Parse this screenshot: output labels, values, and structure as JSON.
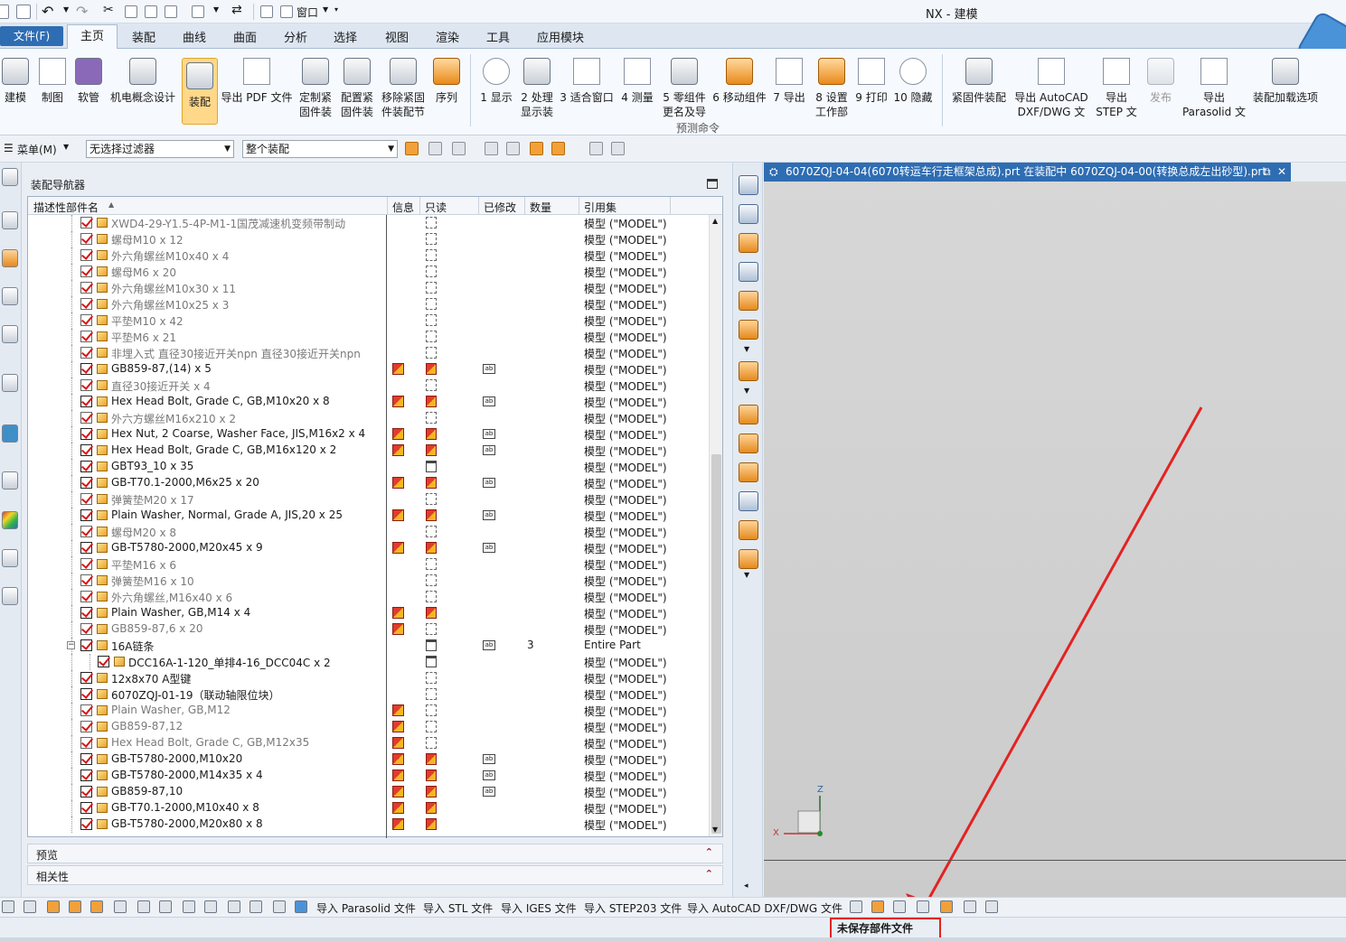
{
  "window": {
    "title": "NX - 建模"
  },
  "menu_tabs": {
    "file": "文件(F)",
    "items": [
      "主页",
      "装配",
      "曲线",
      "曲面",
      "分析",
      "选择",
      "视图",
      "渲染",
      "工具",
      "应用模块"
    ]
  },
  "quick_access": {
    "window_menu": "窗口"
  },
  "ribbon": {
    "buttons": [
      {
        "line1": "建模",
        "line2": ""
      },
      {
        "line1": "制图",
        "line2": ""
      },
      {
        "line1": "软管",
        "line2": ""
      },
      {
        "line1": "机电概念设计",
        "line2": ""
      },
      {
        "line1": "装配",
        "line2": ""
      },
      {
        "line1": "导出 PDF 文件",
        "line2": ""
      },
      {
        "line1": "定制紧",
        "line2": "固件装"
      },
      {
        "line1": "配置紧",
        "line2": "固件装"
      },
      {
        "line1": "移除紧固",
        "line2": "件装配节"
      },
      {
        "line1": "序列",
        "line2": ""
      },
      {
        "line1": "1 显示",
        "line2": ""
      },
      {
        "line1": "2 处理",
        "line2": "显示装"
      },
      {
        "line1": "3 适合窗口",
        "line2": ""
      },
      {
        "line1": "4 测量",
        "line2": ""
      },
      {
        "line1": "5 零组件",
        "line2": "更名及导"
      },
      {
        "line1": "6 移动组件",
        "line2": ""
      },
      {
        "line1": "7 导出",
        "line2": ""
      },
      {
        "line1": "8 设置",
        "line2": "工作部"
      },
      {
        "line1": "9 打印",
        "line2": ""
      },
      {
        "line1": "10 隐藏",
        "line2": ""
      },
      {
        "line1": "紧固件装配",
        "line2": ""
      },
      {
        "line1": "导出 AutoCAD",
        "line2": "DXF/DWG 文"
      },
      {
        "line1": "导出",
        "line2": "STEP 文"
      },
      {
        "line1": "发布",
        "line2": ""
      },
      {
        "line1": "导出",
        "line2": "Parasolid 文"
      },
      {
        "line1": "装配加载选项",
        "line2": ""
      }
    ],
    "group_label": "预测命令"
  },
  "filterbar": {
    "menu": "菜单(M)",
    "selection_filter": "无选择过滤器",
    "scope": "整个装配"
  },
  "navigator": {
    "title": "装配导航器",
    "columns": [
      "描述性部件名",
      "信息",
      "只读",
      "已修改",
      "数量",
      "引用集"
    ],
    "rows": [
      {
        "name": "XWD4-29-Y1.5-4P-M1-1国茂减速机变频带制动",
        "dim": true,
        "info": false,
        "ro": "dash",
        "mod": false,
        "qty": "",
        "ref": "模型 (\"MODEL\")",
        "indent": 0
      },
      {
        "name": "螺母M10 x 12",
        "dim": true,
        "info": false,
        "ro": "dash",
        "mod": false,
        "qty": "",
        "ref": "模型 (\"MODEL\")",
        "indent": 0
      },
      {
        "name": "外六角螺丝M10x40 x 4",
        "dim": true,
        "info": false,
        "ro": "dash",
        "mod": false,
        "qty": "",
        "ref": "模型 (\"MODEL\")",
        "indent": 0
      },
      {
        "name": "螺母M6 x 20",
        "dim": true,
        "info": false,
        "ro": "dash",
        "mod": false,
        "qty": "",
        "ref": "模型 (\"MODEL\")",
        "indent": 0
      },
      {
        "name": "外六角螺丝M10x30 x 11",
        "dim": true,
        "info": false,
        "ro": "dash",
        "mod": false,
        "qty": "",
        "ref": "模型 (\"MODEL\")",
        "indent": 0
      },
      {
        "name": "外六角螺丝M10x25 x 3",
        "dim": true,
        "info": false,
        "ro": "dash",
        "mod": false,
        "qty": "",
        "ref": "模型 (\"MODEL\")",
        "indent": 0
      },
      {
        "name": "平垫M10 x 42",
        "dim": true,
        "info": false,
        "ro": "dash",
        "mod": false,
        "qty": "",
        "ref": "模型 (\"MODEL\")",
        "indent": 0
      },
      {
        "name": "平垫M6 x 21",
        "dim": true,
        "info": false,
        "ro": "dash",
        "mod": false,
        "qty": "",
        "ref": "模型 (\"MODEL\")",
        "indent": 0
      },
      {
        "name": "非埋入式 直径30接近开关npn 直径30接近开关npn",
        "dim": true,
        "info": false,
        "ro": "dash",
        "mod": false,
        "qty": "",
        "ref": "模型 (\"MODEL\")",
        "indent": 0
      },
      {
        "name": "GB859-87,(14) x 5",
        "dim": false,
        "info": true,
        "ro": "red",
        "mod": true,
        "qty": "",
        "ref": "模型 (\"MODEL\")",
        "indent": 0
      },
      {
        "name": "直径30接近开关 x 4",
        "dim": true,
        "info": false,
        "ro": "dash",
        "mod": false,
        "qty": "",
        "ref": "模型 (\"MODEL\")",
        "indent": 0
      },
      {
        "name": "Hex Head Bolt, Grade C, GB,M10x20 x 8",
        "dim": false,
        "info": true,
        "ro": "red",
        "mod": true,
        "qty": "",
        "ref": "模型 (\"MODEL\")",
        "indent": 0
      },
      {
        "name": "外六方螺丝M16x210 x 2",
        "dim": true,
        "info": false,
        "ro": "dash",
        "mod": false,
        "qty": "",
        "ref": "模型 (\"MODEL\")",
        "indent": 0
      },
      {
        "name": "Hex Nut, 2 Coarse, Washer Face, JIS,M16x2 x 4",
        "dim": false,
        "info": true,
        "ro": "red",
        "mod": true,
        "qty": "",
        "ref": "模型 (\"MODEL\")",
        "indent": 0
      },
      {
        "name": "Hex Head Bolt, Grade C, GB,M16x120 x 2",
        "dim": false,
        "info": true,
        "ro": "red",
        "mod": true,
        "qty": "",
        "ref": "模型 (\"MODEL\")",
        "indent": 0
      },
      {
        "name": "GBT93_10 x 35",
        "dim": false,
        "info": false,
        "ro": "disk",
        "mod": false,
        "qty": "",
        "ref": "模型 (\"MODEL\")",
        "indent": 0
      },
      {
        "name": "GB-T70.1-2000,M6x25 x 20",
        "dim": false,
        "info": true,
        "ro": "red",
        "mod": true,
        "qty": "",
        "ref": "模型 (\"MODEL\")",
        "indent": 0
      },
      {
        "name": "弹簧垫M20 x 17",
        "dim": true,
        "info": false,
        "ro": "dash",
        "mod": false,
        "qty": "",
        "ref": "模型 (\"MODEL\")",
        "indent": 0
      },
      {
        "name": "Plain Washer, Normal, Grade A, JIS,20 x 25",
        "dim": false,
        "info": true,
        "ro": "red",
        "mod": true,
        "qty": "",
        "ref": "模型 (\"MODEL\")",
        "indent": 0
      },
      {
        "name": "螺母M20 x 8",
        "dim": true,
        "info": false,
        "ro": "dash",
        "mod": false,
        "qty": "",
        "ref": "模型 (\"MODEL\")",
        "indent": 0
      },
      {
        "name": "GB-T5780-2000,M20x45 x 9",
        "dim": false,
        "info": true,
        "ro": "red",
        "mod": true,
        "qty": "",
        "ref": "模型 (\"MODEL\")",
        "indent": 0
      },
      {
        "name": "平垫M16 x 6",
        "dim": true,
        "info": false,
        "ro": "dash",
        "mod": false,
        "qty": "",
        "ref": "模型 (\"MODEL\")",
        "indent": 0
      },
      {
        "name": "弹簧垫M16 x 10",
        "dim": true,
        "info": false,
        "ro": "dash",
        "mod": false,
        "qty": "",
        "ref": "模型 (\"MODEL\")",
        "indent": 0
      },
      {
        "name": "外六角螺丝,M16x40 x 6",
        "dim": true,
        "info": false,
        "ro": "dash",
        "mod": false,
        "qty": "",
        "ref": "模型 (\"MODEL\")",
        "indent": 0
      },
      {
        "name": "Plain Washer, GB,M14 x 4",
        "dim": false,
        "info": true,
        "ro": "red",
        "mod": false,
        "qty": "",
        "ref": "模型 (\"MODEL\")",
        "indent": 0
      },
      {
        "name": "GB859-87,6 x 20",
        "dim": true,
        "info": true,
        "ro": "dash",
        "mod": false,
        "qty": "",
        "ref": "模型 (\"MODEL\")",
        "indent": 0
      },
      {
        "name": "16A链条",
        "dim": false,
        "info": false,
        "ro": "disk",
        "mod": true,
        "qty": "3",
        "ref": "Entire Part",
        "indent": 0,
        "expand": true
      },
      {
        "name": "DCC16A-1-120_单排4-16_DCC04C x 2",
        "dim": false,
        "info": false,
        "ro": "disk",
        "mod": false,
        "qty": "",
        "ref": "模型 (\"MODEL\")",
        "indent": 1
      },
      {
        "name": "12x8x70 A型键",
        "dim": false,
        "info": false,
        "ro": "dash",
        "mod": false,
        "qty": "",
        "ref": "模型 (\"MODEL\")",
        "indent": 0
      },
      {
        "name": "6070ZQJ-01-19（联动轴限位块）",
        "dim": false,
        "info": false,
        "ro": "dash",
        "mod": false,
        "qty": "",
        "ref": "模型 (\"MODEL\")",
        "indent": 0
      },
      {
        "name": "Plain Washer, GB,M12",
        "dim": true,
        "info": true,
        "ro": "dash",
        "mod": false,
        "qty": "",
        "ref": "模型 (\"MODEL\")",
        "indent": 0
      },
      {
        "name": "GB859-87,12",
        "dim": true,
        "info": true,
        "ro": "dash",
        "mod": false,
        "qty": "",
        "ref": "模型 (\"MODEL\")",
        "indent": 0
      },
      {
        "name": "Hex Head Bolt, Grade C, GB,M12x35",
        "dim": true,
        "info": true,
        "ro": "dash",
        "mod": false,
        "qty": "",
        "ref": "模型 (\"MODEL\")",
        "indent": 0
      },
      {
        "name": "GB-T5780-2000,M10x20",
        "dim": false,
        "info": true,
        "ro": "red",
        "mod": true,
        "qty": "",
        "ref": "模型 (\"MODEL\")",
        "indent": 0
      },
      {
        "name": "GB-T5780-2000,M14x35 x 4",
        "dim": false,
        "info": true,
        "ro": "red",
        "mod": true,
        "qty": "",
        "ref": "模型 (\"MODEL\")",
        "indent": 0
      },
      {
        "name": "GB859-87,10",
        "dim": false,
        "info": true,
        "ro": "red",
        "mod": true,
        "qty": "",
        "ref": "模型 (\"MODEL\")",
        "indent": 0
      },
      {
        "name": "GB-T70.1-2000,M10x40 x 8",
        "dim": false,
        "info": true,
        "ro": "red",
        "mod": false,
        "qty": "",
        "ref": "模型 (\"MODEL\")",
        "indent": 0
      },
      {
        "name": "GB-T5780-2000,M20x80 x 8",
        "dim": false,
        "info": true,
        "ro": "red",
        "mod": false,
        "qty": "",
        "ref": "模型 (\"MODEL\")",
        "indent": 0
      }
    ],
    "preview_label": "预览",
    "dependency_label": "相关性"
  },
  "graphics": {
    "tab_title": "6070ZQJ-04-04(6070转运车行走框架总成).prt 在装配中 6070ZQJ-04-00(转换总成左出砂型).prt",
    "axis_z": "Z",
    "axis_x": "X"
  },
  "bottombar": {
    "imports": [
      "导入 Parasolid 文件",
      "导入 STL 文件",
      "导入 IGES 文件",
      "导入 STEP203 文件",
      "导入 AutoCAD DXF/DWG 文件"
    ]
  },
  "status": {
    "message": "未保存部件文件"
  },
  "colors": {
    "accent": "#2f6db3",
    "annotation_red": "#e32222"
  }
}
